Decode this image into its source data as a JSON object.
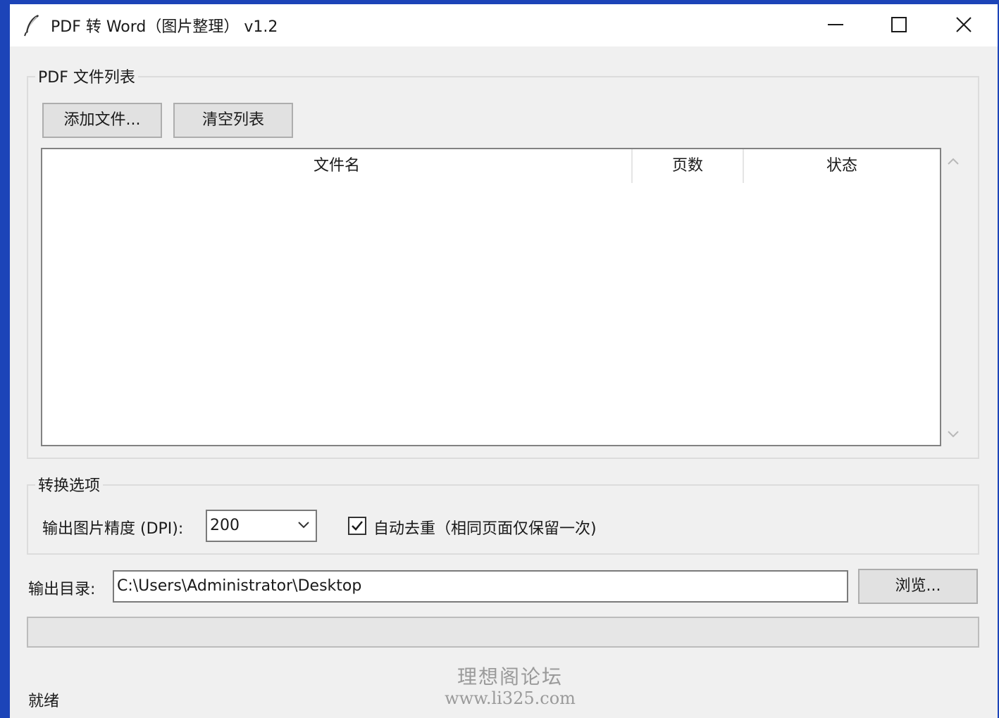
{
  "window": {
    "title": "PDF 转 Word（图片整理） v1.2"
  },
  "file_list": {
    "group_label": "PDF 文件列表",
    "add_button": "添加文件...",
    "clear_button": "清空列表",
    "columns": [
      "文件名",
      "页数",
      "状态"
    ],
    "rows": []
  },
  "options": {
    "group_label": "转换选项",
    "dpi_label": "输出图片精度 (DPI):",
    "dpi_value": "200",
    "dedupe_checked": true,
    "dedupe_label": "自动去重（相同页面仅保留一次)"
  },
  "output": {
    "dir_label": "输出目录:",
    "dir_value": "C:\\Users\\Administrator\\Desktop",
    "browse_button": "浏览..."
  },
  "progress": {
    "value": 0
  },
  "status": {
    "text": "就绪"
  },
  "watermark": {
    "line1": "理想阁论坛",
    "line2": "www.li325.com"
  },
  "colors": {
    "desktop": "#1c44b8",
    "window_bg": "#f0f0f0",
    "titlebar_bg": "#ffffff",
    "button_bg": "#e1e1e1",
    "progress_fill": "#06b025"
  }
}
